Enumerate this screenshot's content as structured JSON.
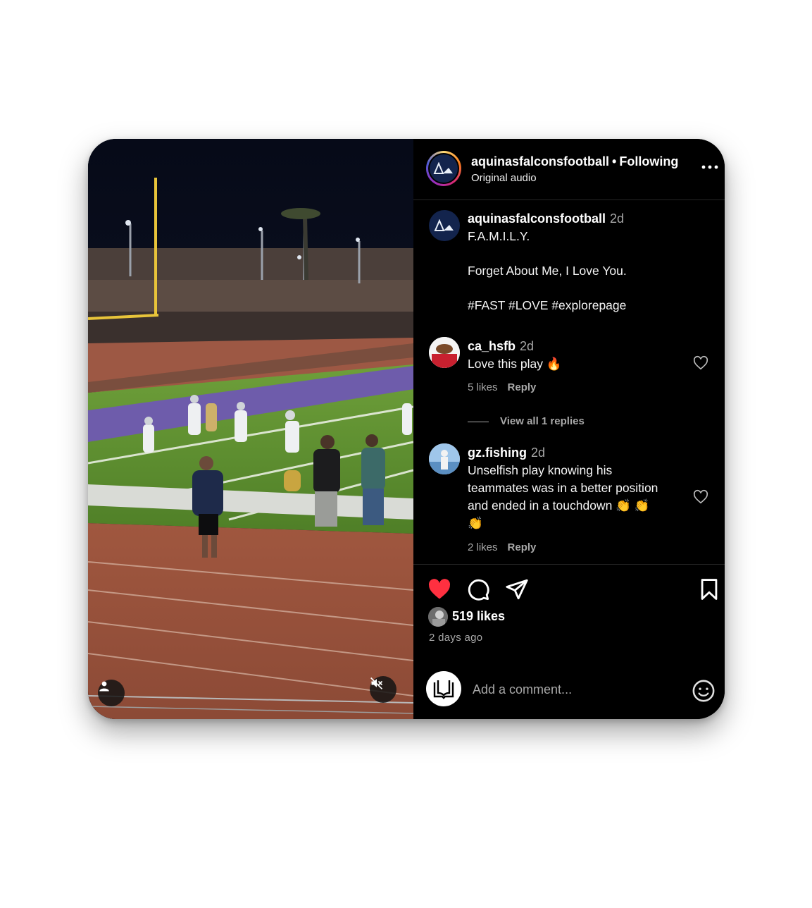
{
  "post": {
    "username": "aquinasfalconsfootball",
    "separator": "•",
    "follow_status": "Following",
    "audio": "Original audio"
  },
  "caption": {
    "username": "aquinasfalconsfootball",
    "time": "2d",
    "lines": [
      "F.A.M.I.L.Y.",
      "Forget About Me, I Love You.",
      "#FAST #LOVE #explorepage"
    ]
  },
  "comments": [
    {
      "username": "ca_hsfb",
      "time": "2d",
      "text": "Love this play 🔥",
      "likes": "5 likes",
      "reply": "Reply",
      "view_replies": "View all 1 replies"
    },
    {
      "username": "gz.fishing",
      "time": "2d",
      "text_lines": [
        "Unselfish play knowing his",
        "teammates was in a better position",
        "and ended in a touchdown 👏 👏",
        "👏"
      ],
      "likes": "2 likes",
      "reply": "Reply"
    }
  ],
  "actions": {
    "like_icon": "heart-filled-icon",
    "comment_icon": "comment-icon",
    "share_icon": "paper-plane-icon",
    "save_icon": "bookmark-icon",
    "liked": true
  },
  "likes_count": "519 likes",
  "posted_ago": "2 days ago",
  "add_comment": {
    "placeholder": "Add a comment..."
  },
  "colors": {
    "like_red": "#ff3040",
    "panel_bg": "#000000",
    "muted_text": "#a8a8a8"
  }
}
